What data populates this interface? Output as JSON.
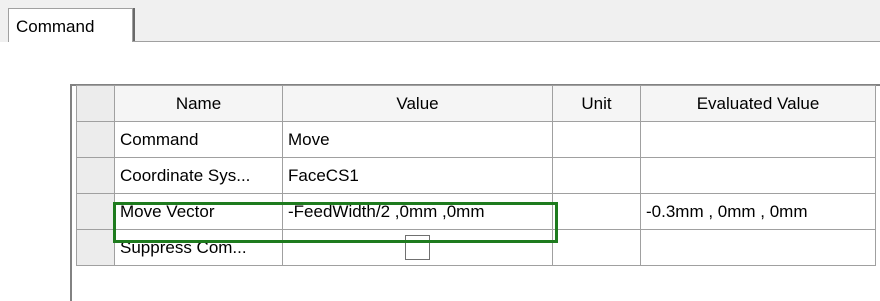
{
  "tabs": [
    {
      "label": "Command",
      "active": true
    }
  ],
  "grid": {
    "columns": [
      "Name",
      "Value",
      "Unit",
      "Evaluated Value"
    ],
    "rows": [
      {
        "name": "Command",
        "value": "Move",
        "unit": "",
        "evaluated": ""
      },
      {
        "name": "Coordinate Sys...",
        "value": "FaceCS1",
        "unit": "",
        "evaluated": ""
      },
      {
        "name": "Move Vector",
        "value": "-FeedWidth/2 ,0mm ,0mm",
        "unit": "",
        "evaluated": "-0.3mm , 0mm , 0mm"
      },
      {
        "name": "Suppress Com...",
        "value_checkbox_checked": false,
        "unit": "",
        "evaluated": ""
      }
    ]
  },
  "colors": {
    "highlight": "#1e7b1e",
    "grid_line": "#a0a0a0",
    "background": "#f0f0f0"
  }
}
